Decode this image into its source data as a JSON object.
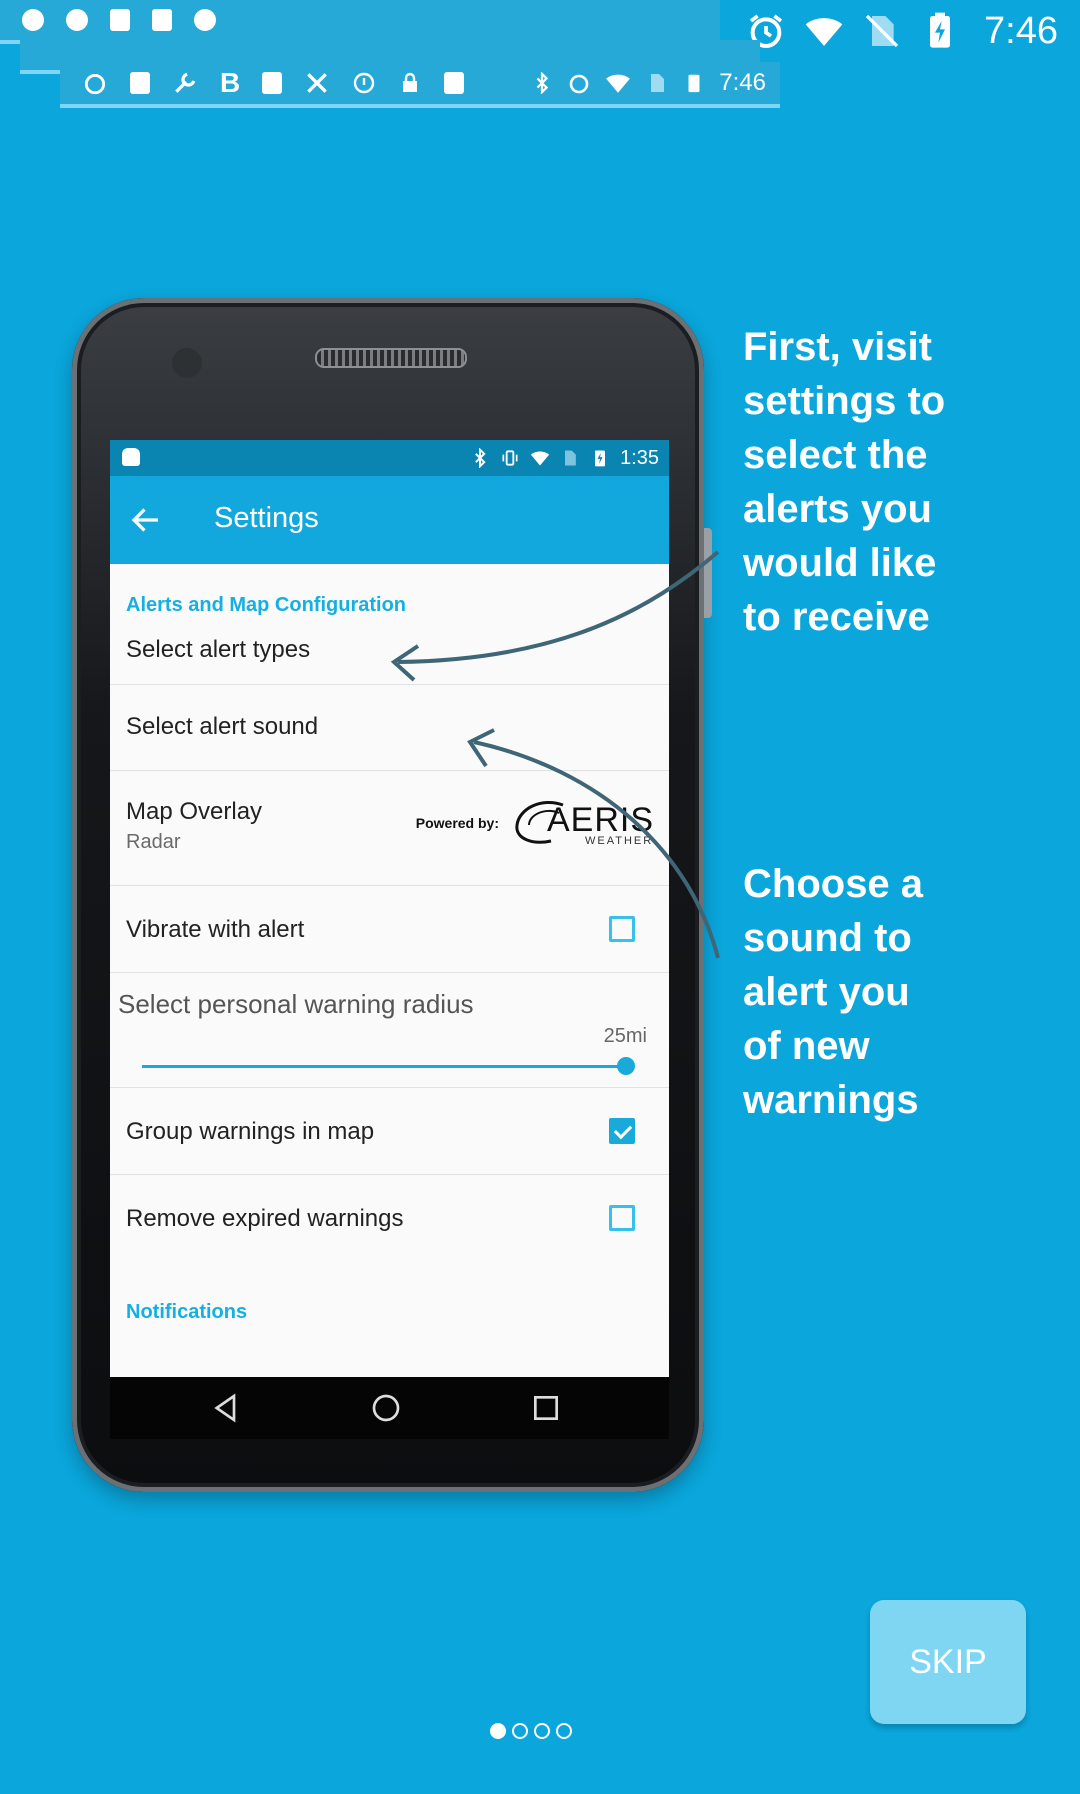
{
  "status_bar": {
    "time": "7:46"
  },
  "glitch_bar": {
    "time": "7:46"
  },
  "phone": {
    "status_time": "1:35",
    "app_title": "Settings",
    "sections": {
      "alerts_header": "Alerts and Map Configuration",
      "notifications_header": "Notifications"
    },
    "prefs": {
      "alert_types": "Select alert types",
      "alert_sound": "Select alert sound",
      "map_overlay": "Map Overlay",
      "map_overlay_value": "Radar",
      "powered_by": "Powered by:",
      "aeris_logo": "AERIS",
      "aeris_sub": "WEATHER",
      "vibrate": "Vibrate with alert",
      "vibrate_checked": false,
      "radius_label": "Select personal warning radius",
      "radius_value": "25mi",
      "group_warnings": "Group warnings in map",
      "group_warnings_checked": true,
      "remove_expired": "Remove expired warnings",
      "remove_expired_checked": false
    }
  },
  "callouts": {
    "first": [
      "First, visit",
      "settings to",
      "select the",
      "alerts you",
      "would like",
      "to receive"
    ],
    "second": [
      "Choose a",
      "sound to",
      "alert you",
      "of new",
      "warnings"
    ]
  },
  "skip_label": "SKIP",
  "pager": {
    "total": 4,
    "active": 0
  },
  "colors": {
    "background": "#0aa6dc",
    "accent": "#1aaad9",
    "skip_bg": "#7fd6f3"
  }
}
